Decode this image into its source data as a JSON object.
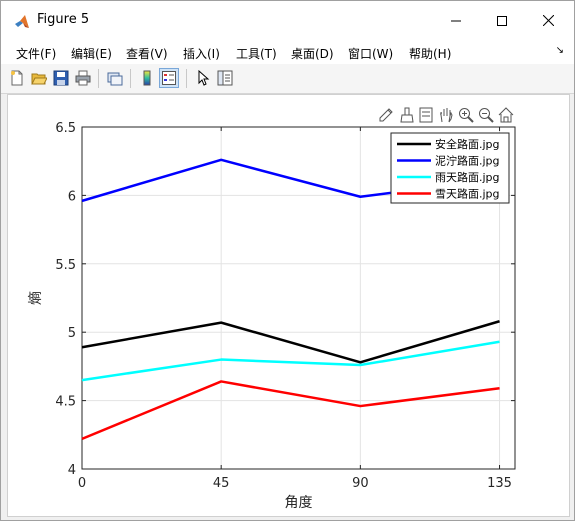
{
  "window": {
    "title": "Figure 5",
    "controls": {
      "minimize_icon": "minimize-icon",
      "maximize_icon": "maximize-icon",
      "close_icon": "close-icon"
    }
  },
  "menu": [
    {
      "label": "文件(F)"
    },
    {
      "label": "编辑(E)"
    },
    {
      "label": "查看(V)"
    },
    {
      "label": "插入(I)"
    },
    {
      "label": "工具(T)"
    },
    {
      "label": "桌面(D)"
    },
    {
      "label": "窗口(W)"
    },
    {
      "label": "帮助(H)"
    }
  ],
  "toolbar": [
    "new-figure-icon",
    "open-file-icon",
    "save-icon",
    "print-icon",
    "link-plot-icon",
    "colorbar-icon",
    "legend-icon",
    "edit-plot-icon",
    "property-inspector-icon"
  ],
  "axes_toolbar": [
    "export-icon",
    "brush-icon",
    "data-tips-icon",
    "pan-icon",
    "zoom-in-icon",
    "zoom-out-icon",
    "home-icon"
  ],
  "chart_data": {
    "type": "line",
    "x": [
      0,
      45,
      90,
      135
    ],
    "xlabel": "角度",
    "ylabel": "熵",
    "xlim": [
      0,
      140
    ],
    "ylim": [
      4,
      6.5
    ],
    "xticks": [
      "0",
      "45",
      "90",
      "135"
    ],
    "yticks": [
      "4",
      "4.5",
      "5",
      "5.5",
      "6",
      "6.5"
    ],
    "grid": true,
    "legend_position": "top-right",
    "series": [
      {
        "name": "安全路面.jpg",
        "color": "#000000",
        "values": [
          4.89,
          5.07,
          4.78,
          5.08
        ]
      },
      {
        "name": "泥泞路面.jpg",
        "color": "#0000ff",
        "values": [
          5.96,
          6.26,
          5.99,
          6.12
        ]
      },
      {
        "name": "雨天路面.jpg",
        "color": "#00ffff",
        "values": [
          4.65,
          4.8,
          4.76,
          4.93
        ]
      },
      {
        "name": "雪天路面.jpg",
        "color": "#ff0000",
        "values": [
          4.22,
          4.64,
          4.46,
          4.59
        ]
      }
    ]
  }
}
